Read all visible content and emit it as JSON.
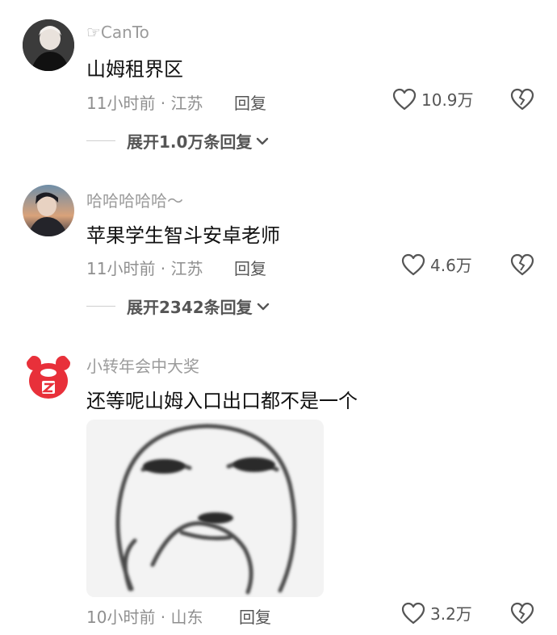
{
  "comments": [
    {
      "username": "☞CanTo",
      "text": "山姆租界区",
      "time_location": "11小时前 · 江苏",
      "reply_label": "回复",
      "like_count": "10.9万",
      "expand_label": "展开1.0万条回复"
    },
    {
      "username": "哈哈哈哈哈～",
      "text": "苹果学生智斗安卓老师",
      "time_location": "11小时前 · 江苏",
      "reply_label": "回复",
      "like_count": "4.6万",
      "expand_label": "展开2342条回复"
    },
    {
      "username": "小转年会中大奖",
      "text": "还等呢山姆入口出口都不是一个",
      "time_location": "10小时前 · 山东",
      "reply_label": "回复",
      "like_count": "3.2万"
    }
  ],
  "icons": {
    "like": "heart-outline-icon",
    "dislike": "broken-heart-icon",
    "expand": "chevron-down-icon"
  },
  "colors": {
    "text_primary": "#111111",
    "text_secondary": "#8f8f8f",
    "background": "#ffffff"
  }
}
